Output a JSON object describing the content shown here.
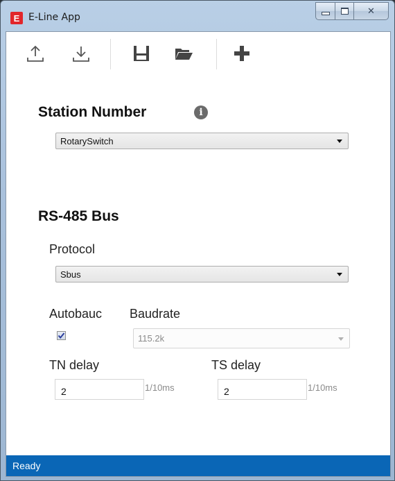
{
  "window": {
    "title": "E-Line App",
    "app_icon_letter": "E"
  },
  "toolbar": {
    "icons": [
      "upload-icon",
      "download-icon",
      "save-icon",
      "open-folder-icon",
      "add-icon"
    ]
  },
  "station": {
    "heading": "Station Number",
    "select_value": "RotarySwitch"
  },
  "bus": {
    "heading": "RS-485 Bus",
    "protocol_label": "Protocol",
    "protocol_value": "Sbus",
    "autobaud_label": "Autobauc",
    "autobaud_checked": true,
    "baudrate_label": "Baudrate",
    "baudrate_value": "115.2k",
    "tn_delay_label": "TN delay",
    "tn_delay_value": "2",
    "tn_delay_unit": "1/10ms",
    "ts_delay_label": "TS delay",
    "ts_delay_value": "2",
    "ts_delay_unit": "1/10ms"
  },
  "status": {
    "text": "Ready"
  },
  "colors": {
    "status_bar": "#0a66b6",
    "app_icon": "#e2262b"
  }
}
